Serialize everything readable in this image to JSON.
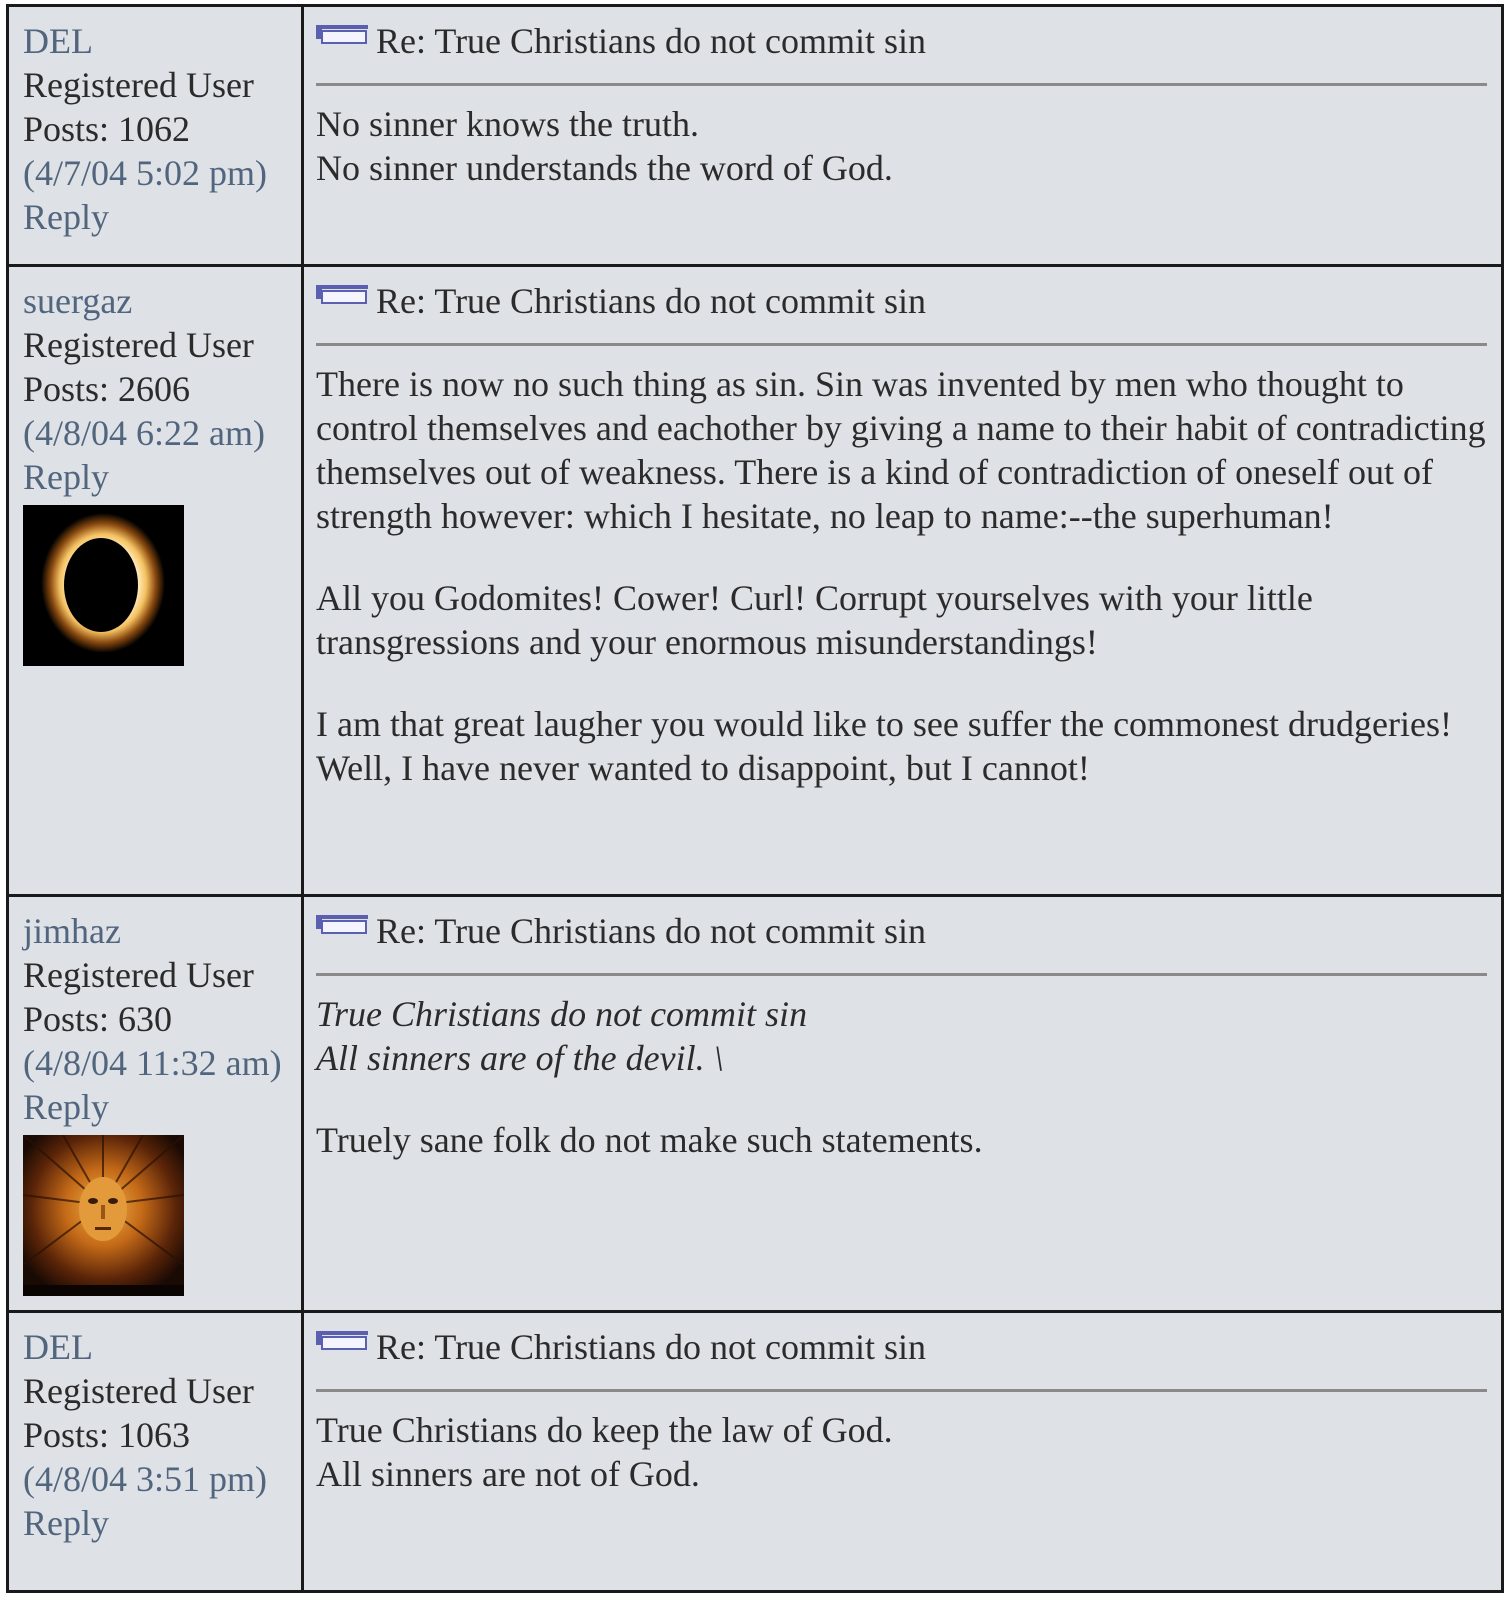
{
  "posts": [
    {
      "username": "DEL",
      "role": "Registered User",
      "posts_label": "Posts: 1062",
      "date": "(4/7/04 5:02 pm)",
      "reply": "Reply",
      "subject": "Re: True Christians do not commit sin",
      "body": {
        "p1": [
          "No sinner knows the truth.",
          "No sinner understands the word of God."
        ]
      }
    },
    {
      "username": "suergaz",
      "role": "Registered User",
      "posts_label": "Posts: 2606",
      "date": "(4/8/04 6:22 am)",
      "reply": "Reply",
      "avatar": "eclipse-avatar",
      "subject": "Re: True Christians do not commit sin",
      "body": {
        "p1": "There is now no such thing as sin. Sin was invented by men who thought to control themselves and eachother by giving a name to their habit of contradicting themselves out of weakness. There is a kind of contradiction of oneself out of strength however: which I hesitate, no leap to name:--the superhuman!",
        "p2": "All you Godomites! Cower! Curl! Corrupt yourselves with your little transgressions and your enormous misunderstandings!",
        "p3": "I am that great laugher you would like to see suffer the commonest drudgeries! Well, I have never wanted to disappoint, but I cannot!"
      }
    },
    {
      "username": "jimhaz",
      "role": "Registered User",
      "posts_label": "Posts: 630",
      "date": "(4/8/04 11:32 am)",
      "reply": "Reply",
      "avatar": "sun-face-avatar",
      "subject": "Re: True Christians do not commit sin",
      "body": {
        "quote": [
          "True Christians do not commit sin",
          "All sinners are of the devil. \\"
        ],
        "p1": "Truely sane folk do not make such statements."
      }
    },
    {
      "username": "DEL",
      "role": "Registered User",
      "posts_label": "Posts: 1063",
      "date": "(4/8/04 3:51 pm)",
      "reply": "Reply",
      "subject": "Re: True Christians do not commit sin",
      "body": {
        "p1": [
          "True Christians do keep the law of God.",
          "All sinners are not of God."
        ]
      }
    }
  ],
  "icons": {
    "post": "post-icon"
  },
  "colors": {
    "link": "#51657f",
    "cell_bg": "#dee1e5",
    "text": "#2b2b2b",
    "border": "#1a1a1a"
  }
}
